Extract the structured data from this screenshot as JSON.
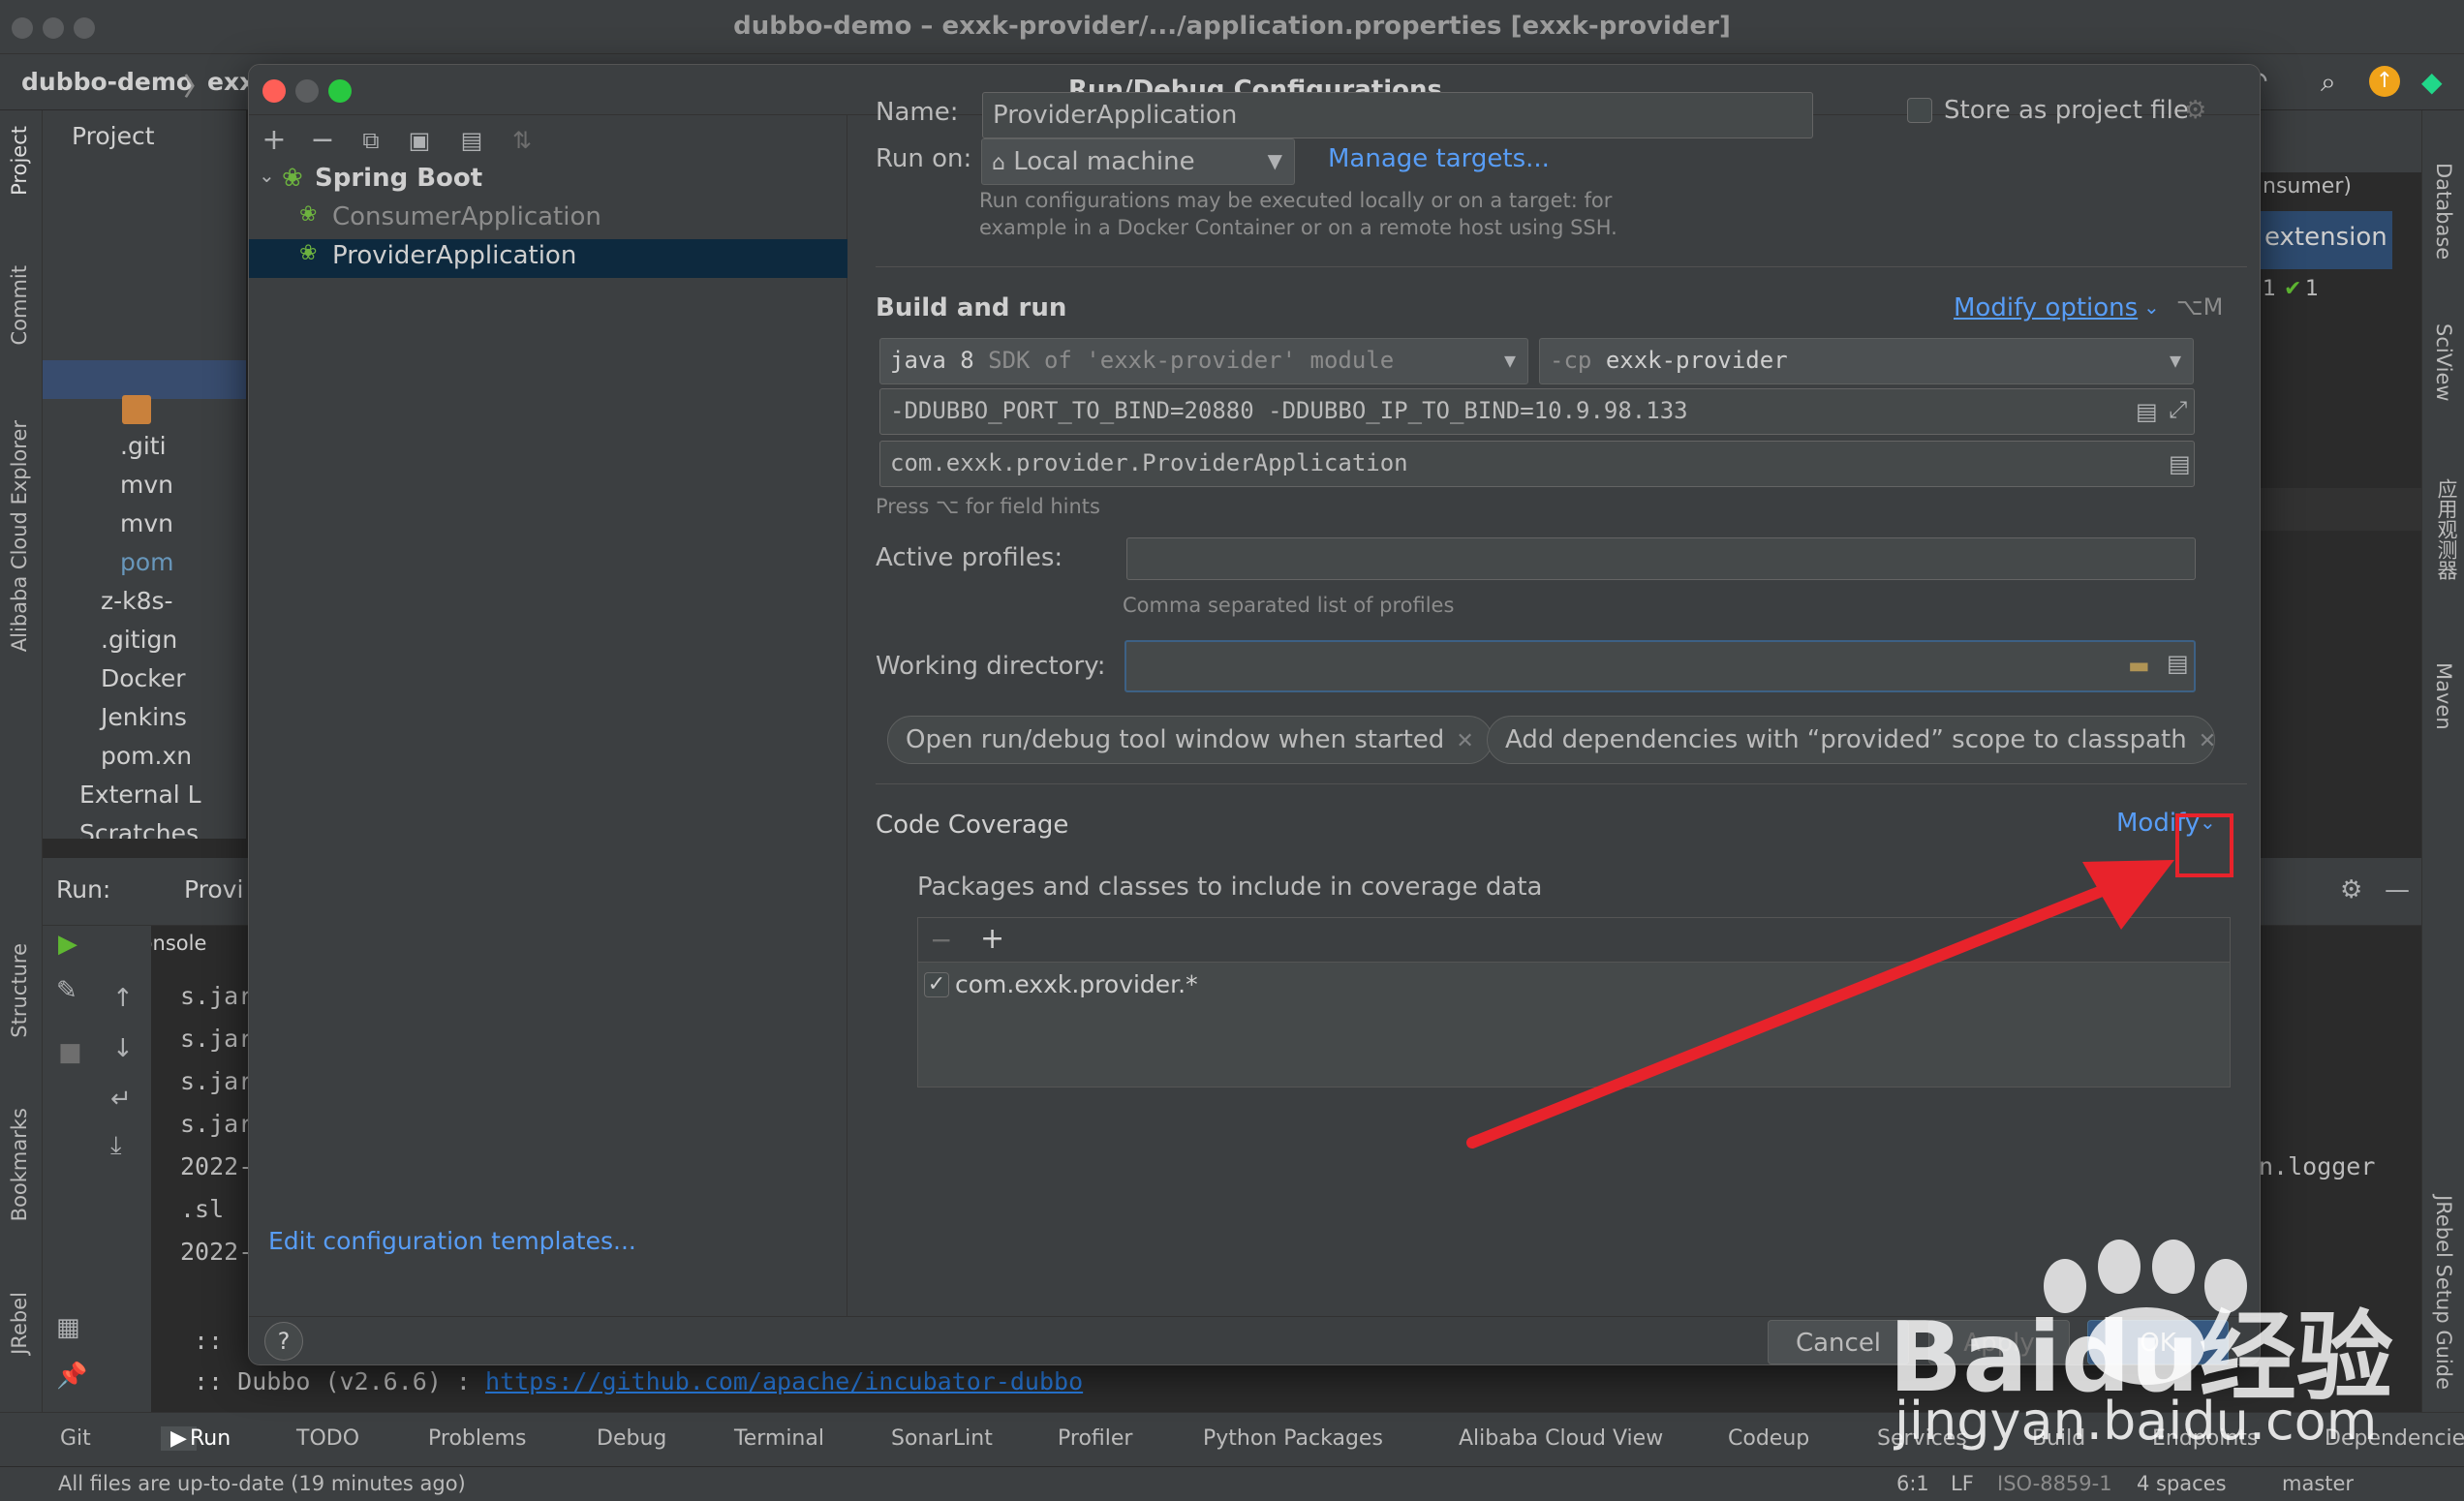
{
  "ide": {
    "window_title": "dubbo-demo – exxk-provider/.../application.properties [exxk-provider]",
    "breadcrumb_project": "dubbo-demo",
    "breadcrumb_module": "exx",
    "project_tab": "Project",
    "left_strip": [
      "Project",
      "Commit",
      "Alibaba Cloud Explorer",
      "Structure",
      "Bookmarks",
      "JRebel"
    ],
    "right_strip": [
      "Database",
      "SciView",
      "应用观测器",
      "Maven",
      "JRebel Setup Guide"
    ],
    "tree_items": [
      ".giti",
      "mvn",
      "mvn",
      "pom",
      "z-k8s-",
      ".gitign",
      "Docker",
      "Jenkins",
      "pom.xn",
      "External L",
      "Scratches"
    ],
    "run_label": "Run:",
    "run_config_tab": "Provi",
    "console_tab": "Console",
    "console_lines": [
      "s.jar",
      "s.jar",
      "s.jar",
      "s.jar",
      "2022-",
      ".sl",
      "2022-",
      ":: ",
      ":: Dubbo (v2.6.6) : "
    ],
    "console_link": "https://github.com/apache/incubator-dubbo",
    "right_editor": {
      "tab": "nsumer)",
      "extension": "extension",
      "counter_left": "1",
      "counter_right": "1",
      "line_n": "n",
      "logger": "n.logger"
    },
    "tool_tabs": [
      "Git",
      "Run",
      "TODO",
      "Problems",
      "Debug",
      "Terminal",
      "SonarLint",
      "Profiler",
      "Python Packages",
      "Alibaba Cloud View",
      "Codeup",
      "Services",
      "Build",
      "Endpoints",
      "Dependencies"
    ],
    "status": {
      "message": "All files are up-to-date (19 minutes ago)",
      "position": "6:1",
      "line_sep": "LF",
      "encoding": "ISO-8859-1",
      "indent": "4 spaces",
      "branch": "master"
    }
  },
  "dialog": {
    "title": "Run/Debug Configurations",
    "tree": {
      "group": "Spring Boot",
      "items": [
        "ConsumerApplication",
        "ProviderApplication"
      ],
      "selected": "ProviderApplication"
    },
    "edit_templates": "Edit configuration templates...",
    "name_label": "Name:",
    "name_value": "ProviderApplication",
    "store_as_project_file": "Store as project file",
    "run_on_label": "Run on:",
    "run_on_value": "Local machine",
    "manage_targets": "Manage targets...",
    "run_on_hint_1": "Run configurations may be executed locally or on a target: for",
    "run_on_hint_2": "example in a Docker Container or on a remote host using SSH.",
    "build_and_run": "Build and run",
    "modify_options": "Modify options",
    "modify_options_shortcut": "⌥M",
    "jdk_main": "java 8",
    "jdk_detail": "SDK of 'exxk-provider' module",
    "cp_flag": "-cp",
    "cp_value": "exxk-provider",
    "vm_options": "-DDUBBO_PORT_TO_BIND=20880 -DDUBBO_IP_TO_BIND=10.9.98.133",
    "main_class": "com.exxk.provider.ProviderApplication",
    "field_hint": "Press ⌥ for field hints",
    "active_profiles_label": "Active profiles:",
    "active_profiles_value": "",
    "active_profiles_hint": "Comma separated list of profiles",
    "working_dir_label": "Working directory:",
    "working_dir_value": "",
    "chips": [
      "Open run/debug tool window when started",
      "Add dependencies with “provided” scope to classpath"
    ],
    "code_coverage": "Code Coverage",
    "modify": "Modify",
    "coverage_packages_label": "Packages and classes to include in coverage data",
    "coverage_entries": [
      "com.exxk.provider.*"
    ],
    "help": "?",
    "cancel": "Cancel",
    "apply": "Apply",
    "ok": "OK"
  },
  "watermark": {
    "brand": "Baidu经验",
    "url": "jingyan.baidu.com"
  },
  "colors": {
    "accent_link": "#589df6",
    "selection": "#0d293e",
    "annotation_red": "#e8232b",
    "dialog_bg": "#3c3f41"
  }
}
